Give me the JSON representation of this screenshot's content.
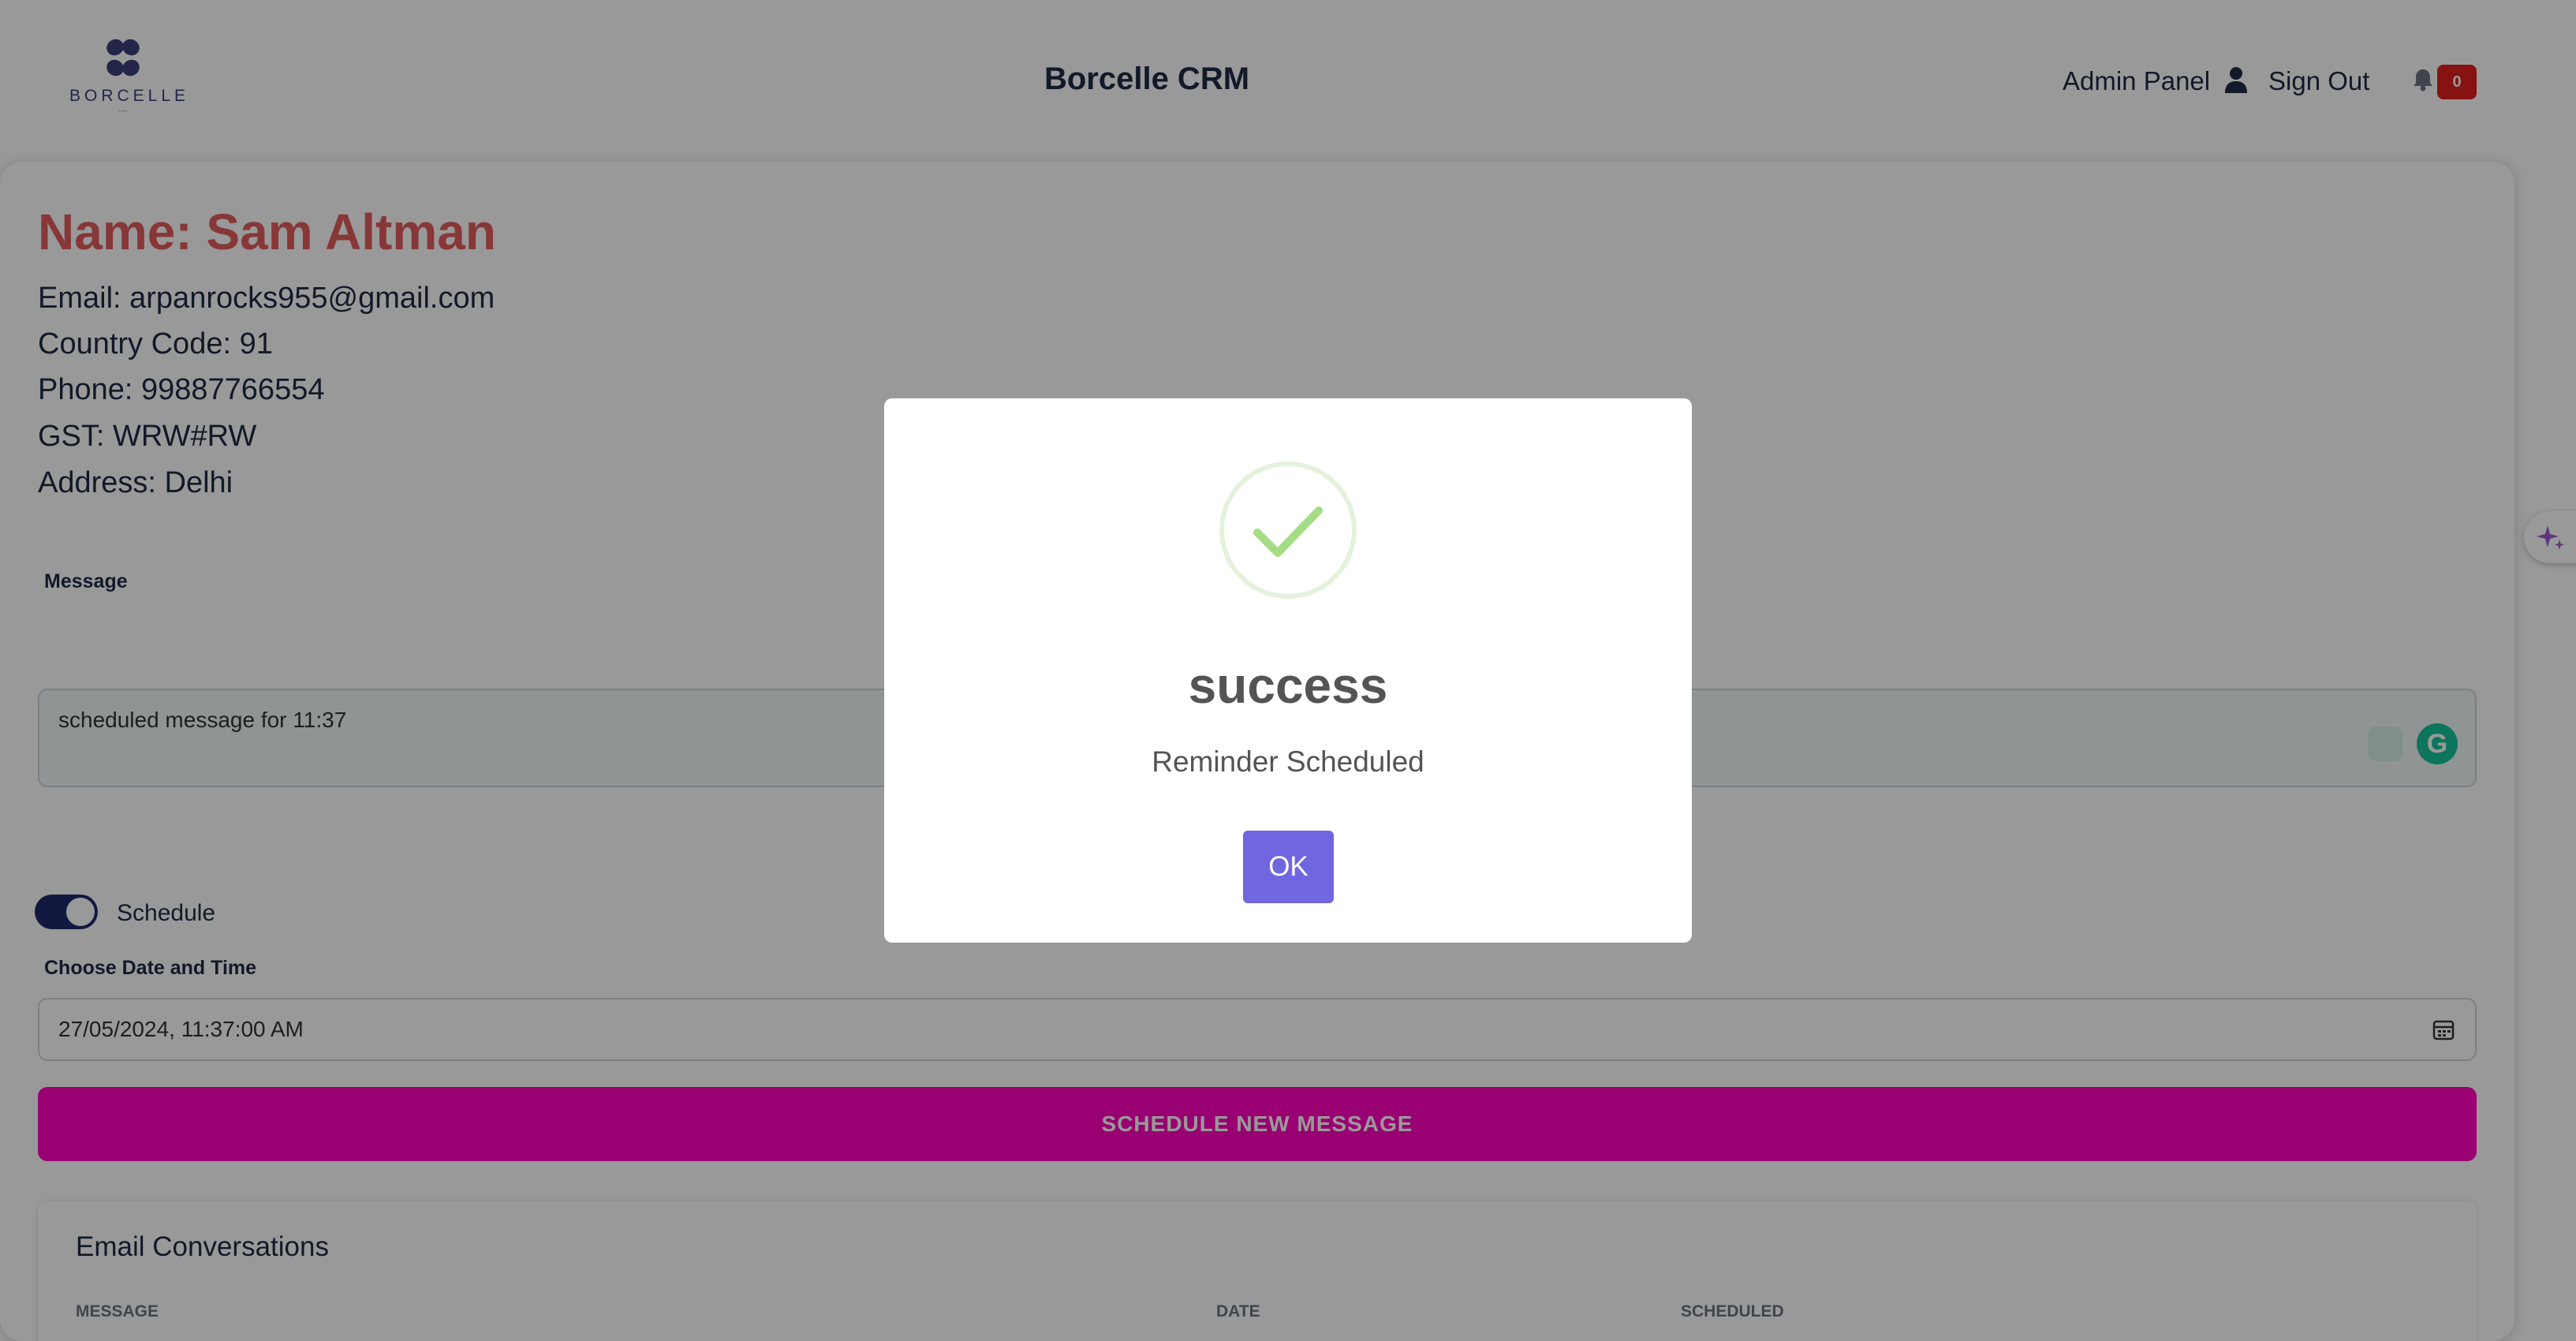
{
  "header": {
    "logo_text": "BORCELLE",
    "logo_subtext": "----",
    "title": "Borcelle CRM",
    "admin_link": "Admin Panel",
    "sign_out": "Sign Out",
    "notification_count": "0",
    "icons": [
      "logo-icon",
      "user-icon",
      "bell-icon"
    ]
  },
  "contact": {
    "name": "Name: Sam Altman",
    "email": "Email: arpanrocks955@gmail.com",
    "country_code": "Country Code: 91",
    "phone": "Phone: 99887766554",
    "gst": "GST: WRW#RW",
    "address": "Address: Delhi"
  },
  "form": {
    "message_label": "Message",
    "message_value": "scheduled message for 11:37",
    "schedule_label": "Schedule",
    "schedule_on": true,
    "datetime_label": "Choose Date and Time",
    "datetime_value": "27/05/2024, 11:37:00 AM",
    "submit_label": "SCHEDULE NEW MESSAGE"
  },
  "conversations": {
    "title": "Email Conversations",
    "columns": [
      "MESSAGE",
      "DATE",
      "SCHEDULED"
    ]
  },
  "modal": {
    "title": "success",
    "text": "Reminder Scheduled",
    "ok_label": "OK",
    "icon": "success-check-icon"
  },
  "colors": {
    "name_accent": "#e25d5d",
    "primary_button": "#ff00bf",
    "modal_button": "#7066e0",
    "toggle": "#1f2a6c",
    "badge": "#e01e1e",
    "success": "#a5dc86"
  }
}
